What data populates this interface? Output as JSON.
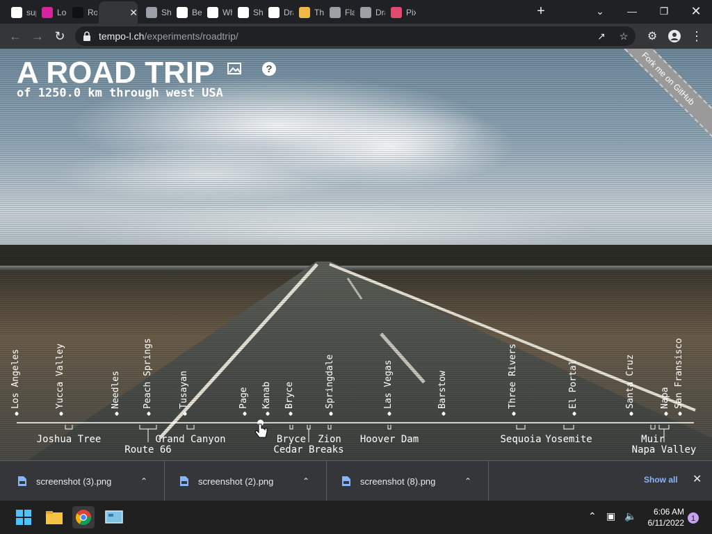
{
  "browser": {
    "tabs": [
      {
        "title": "sup",
        "favicon": "google-icon",
        "color": "#ffffff"
      },
      {
        "title": "Log",
        "favicon": "instagram-icon",
        "color": "#d6249f"
      },
      {
        "title": "Roa",
        "favicon": "e-icon",
        "color": "#111111"
      },
      {
        "title": "",
        "favicon": "car-icon",
        "color": "#35363a",
        "active": true
      },
      {
        "title": "Shi",
        "favicon": "globe-icon",
        "color": "#9aa0a6"
      },
      {
        "title": "Bec",
        "favicon": "book-icon",
        "color": "#ffffff"
      },
      {
        "title": "Wh",
        "favicon": "wikipedia-icon",
        "color": "#ffffff"
      },
      {
        "title": "Sha",
        "favicon": "shader-icon",
        "color": "#ffffff"
      },
      {
        "title": "Dra",
        "favicon": "github-icon",
        "color": "#ffffff"
      },
      {
        "title": "The",
        "favicon": "hexagon-icon",
        "color": "#f0b848"
      },
      {
        "title": "Fla",
        "favicon": "globe-icon",
        "color": "#9aa0a6"
      },
      {
        "title": "Dra",
        "favicon": "globe-icon",
        "color": "#9aa0a6"
      },
      {
        "title": "Pix",
        "favicon": "js-icon",
        "color": "#e34a6f"
      }
    ],
    "url_host": "tempo-l.ch",
    "url_path": "/experiments/roadtrip/"
  },
  "page": {
    "title": "A ROAD TRIP",
    "subtitle": "of 1250.0 km through west USA",
    "ribbon": "Fork me on GitHub",
    "cities": [
      "Los Angeles",
      "Yucca Valley",
      "Needles",
      "Peach Springs",
      "Tusayan",
      "Page",
      "Kanab",
      "Bryce",
      "Springdale",
      "Las Vegas",
      "Barstow",
      "Three Rivers",
      "El Portal",
      "Santa Cruz",
      "Napa",
      "San Fransisco"
    ],
    "regions_row1": [
      "Joshua Tree",
      "Grand Canyon",
      "Bryce",
      "Zion",
      "Hoover Dam",
      "Sequoia",
      "Yosemite",
      "Muir"
    ],
    "regions_row2": [
      "Route 66",
      "Cedar Breaks",
      "Napa Valley"
    ],
    "progress": 0.36
  },
  "downloads": {
    "items": [
      "screenshot (3).png",
      "screenshot (2).png",
      "screenshot (8).png"
    ],
    "show_all": "Show all"
  },
  "taskbar": {
    "time": "6:06 AM",
    "date": "6/11/2022",
    "notifications": "1"
  }
}
